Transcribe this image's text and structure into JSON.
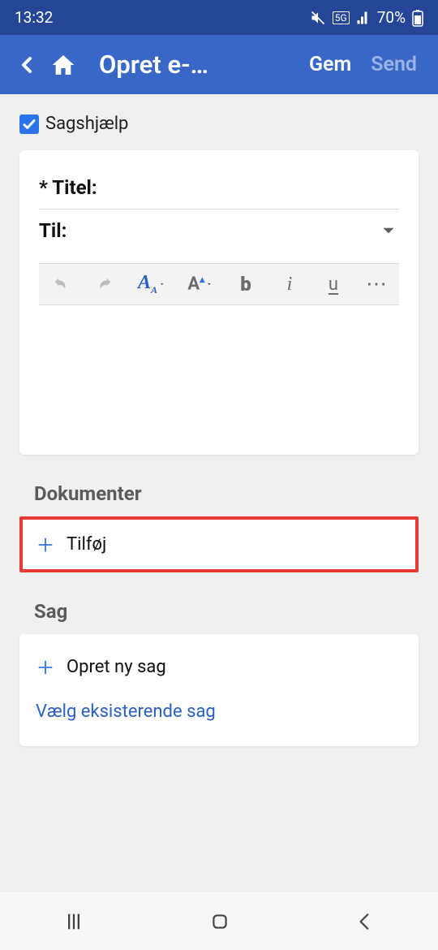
{
  "statusbar": {
    "time": "13:32",
    "battery": "70%"
  },
  "appbar": {
    "title": "Opret e-…",
    "save_label": "Gem",
    "send_label": "Send"
  },
  "helper": {
    "label": "Sagshjælp",
    "checked": true
  },
  "fields": {
    "title_label": "* Titel:",
    "to_label": "Til:"
  },
  "toolbar": {
    "undo": "↶",
    "redo": "↷",
    "font_family": "A",
    "font_size": "A",
    "bold": "b",
    "italic": "i",
    "underline": "u",
    "more": "⋯"
  },
  "sections": {
    "documents": {
      "title": "Dokumenter",
      "add_label": "Tilføj"
    },
    "case": {
      "title": "Sag",
      "new_label": "Opret ny sag",
      "existing_label": "Vælg eksisterende sag"
    }
  }
}
